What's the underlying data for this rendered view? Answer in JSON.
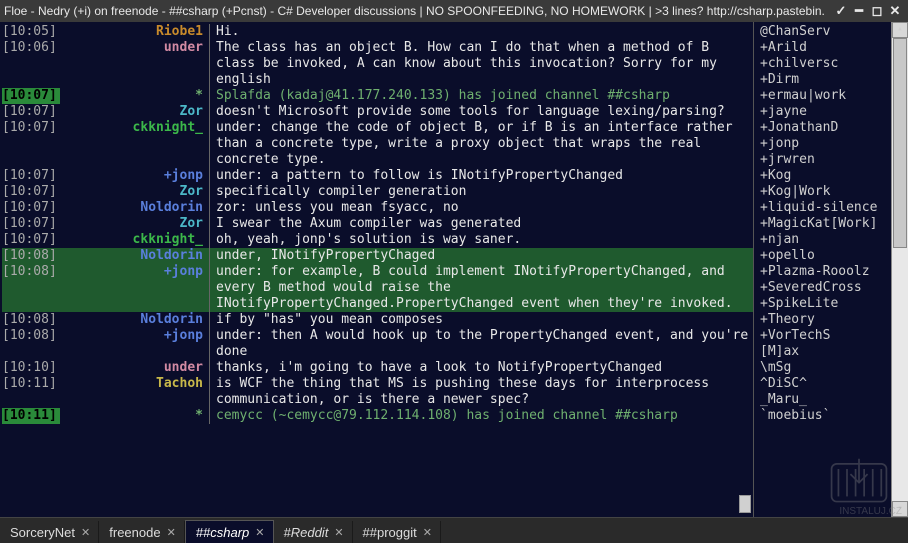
{
  "window": {
    "title": "Floe - Nedry (+i) on freenode - ##csharp (+Pcnst) - C# Developer discussions | NO SPOONFEEDING, NO HOMEWORK | >3 lines? http://csharp.pastebin."
  },
  "messages": [
    {
      "ts": "[10:05]",
      "nick": "Riobe1",
      "cls": "c-orange",
      "text": "Hi.",
      "event": false,
      "hl": false
    },
    {
      "ts": "[10:06]",
      "nick": "under",
      "cls": "c-pink",
      "text": "The class has an object B. How can I do that when a method of B class be invoked, A can know about this invocation? Sorry for my english",
      "event": false,
      "hl": false
    },
    {
      "ts": "[10:07]",
      "nick": "*",
      "cls": "c-event",
      "text": "Splafda (kadaj@41.177.240.133) has joined channel ##csharp",
      "event": true,
      "hl": false
    },
    {
      "ts": "[10:07]",
      "nick": "Zor",
      "cls": "c-cyan",
      "text": "doesn't Microsoft provide some tools for language lexing/parsing?",
      "event": false,
      "hl": false
    },
    {
      "ts": "[10:07]",
      "nick": "ckknight_",
      "cls": "c-green",
      "text": "under: change the code of object B, or if B is an interface rather than a concrete type, write a proxy object that wraps the real concrete type.",
      "event": false,
      "hl": false
    },
    {
      "ts": "[10:07]",
      "nick": "+jonp",
      "cls": "c-blue",
      "text": "under: a pattern to follow is INotifyPropertyChanged",
      "event": false,
      "hl": false
    },
    {
      "ts": "[10:07]",
      "nick": "Zor",
      "cls": "c-cyan",
      "text": "specifically compiler generation",
      "event": false,
      "hl": false
    },
    {
      "ts": "[10:07]",
      "nick": "Noldorin",
      "cls": "c-blue",
      "text": "zor: unless you mean fsyacc, no",
      "event": false,
      "hl": false
    },
    {
      "ts": "[10:07]",
      "nick": "Zor",
      "cls": "c-cyan",
      "text": "I swear the Axum compiler was generated",
      "event": false,
      "hl": false
    },
    {
      "ts": "[10:07]",
      "nick": "ckknight_",
      "cls": "c-green",
      "text": "oh, yeah, jonp's solution is way saner.",
      "event": false,
      "hl": false
    },
    {
      "ts": "[10:08]",
      "nick": "Noldorin",
      "cls": "c-blue",
      "text": "under, INotifyPropertyChaged",
      "event": false,
      "hl": true
    },
    {
      "ts": "[10:08]",
      "nick": "+jonp",
      "cls": "c-blue",
      "text": "under: for example, B could implement INotifyPropertyChanged, and every B method would raise the INotifyPropertyChanged.PropertyChanged event when they're invoked.",
      "event": false,
      "hl": true
    },
    {
      "ts": "[10:08]",
      "nick": "Noldorin",
      "cls": "c-blue",
      "text": "if by \"has\" you mean composes",
      "event": false,
      "hl": false
    },
    {
      "ts": "[10:08]",
      "nick": "+jonp",
      "cls": "c-blue",
      "text": "under: then A would hook up to the PropertyChanged event, and you're done",
      "event": false,
      "hl": false
    },
    {
      "ts": "[10:10]",
      "nick": "under",
      "cls": "c-pink",
      "text": "thanks, i'm going to have a look to NotifyPropertyChanged",
      "event": false,
      "hl": false
    },
    {
      "ts": "[10:11]",
      "nick": "Tachoh",
      "cls": "c-yellow",
      "text": "is WCF the thing that MS is pushing these days for interprocess communication, or is there a newer spec?",
      "event": false,
      "hl": false
    },
    {
      "ts": "[10:11]",
      "nick": "*",
      "cls": "c-event",
      "text": "cemycc (~cemycc@79.112.114.108) has joined channel ##csharp",
      "event": true,
      "hl": false
    }
  ],
  "nicklist": [
    "@ChanServ",
    "+Arild",
    "+chilversc",
    "+Dirm",
    "+ermau|work",
    "+jayne",
    "+JonathanD",
    "+jonp",
    "+jrwren",
    "+Kog",
    "+Kog|Work",
    "+liquid-silence",
    "+MagicKat[Work]",
    "+njan",
    "+opello",
    "+Plazma-Rooolz",
    "+SeveredCross",
    "+SpikeLite",
    "+Theory",
    "+VorTechS",
    "[M]ax",
    "\\mSg",
    "^DiSC^",
    "_Maru_",
    "`moebius`"
  ],
  "tabs": [
    {
      "label": "SorceryNet",
      "active": false,
      "alert": false,
      "closable": true
    },
    {
      "label": "freenode",
      "active": false,
      "alert": false,
      "closable": true
    },
    {
      "label": "##csharp",
      "active": true,
      "alert": false,
      "closable": true
    },
    {
      "label": "#Reddit",
      "active": false,
      "alert": true,
      "closable": true
    },
    {
      "label": "##proggit",
      "active": false,
      "alert": false,
      "closable": true
    }
  ],
  "watermark": {
    "text": "INSTALUJ.CZ"
  }
}
